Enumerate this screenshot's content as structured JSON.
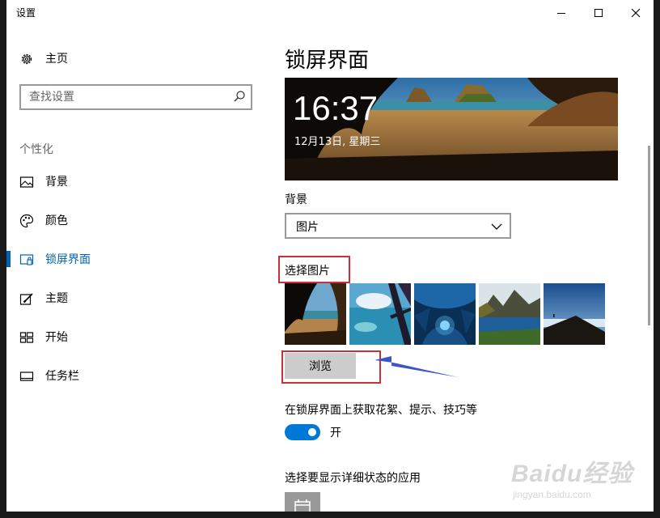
{
  "window": {
    "title": "设置",
    "controls": [
      "minimize",
      "maximize",
      "close"
    ]
  },
  "sidebar": {
    "home_label": "主页",
    "home_icon": "gear-icon",
    "search_placeholder": "查找设置",
    "search_icon": "search-icon",
    "section_label": "个性化",
    "items": [
      {
        "label": "背景",
        "icon": "image-icon",
        "active": false
      },
      {
        "label": "颜色",
        "icon": "palette-icon",
        "active": false
      },
      {
        "label": "锁屏界面",
        "icon": "lock-screen-icon",
        "active": true
      },
      {
        "label": "主题",
        "icon": "brush-icon",
        "active": false
      },
      {
        "label": "开始",
        "icon": "start-icon",
        "active": false
      },
      {
        "label": "任务栏",
        "icon": "taskbar-icon",
        "active": false
      }
    ],
    "accent_color": "#0063b1"
  },
  "main": {
    "title": "锁屏界面",
    "preview": {
      "time": "16:37",
      "date": "12月13日, 星期三"
    },
    "background_label": "背景",
    "background_value": "图片",
    "choose_picture_label": "选择图片",
    "thumbnails": [
      "beach-cave",
      "window-sea",
      "ice-cave",
      "mountain-lake",
      "coast-sunrise"
    ],
    "browse_label": "浏览",
    "spotlight_label": "在锁屏界面上获取花絮、提示、技巧等",
    "toggle": {
      "state": "on",
      "label": "开"
    },
    "detail_apps_label": "选择要显示详细状态的应用",
    "detail_app_icon": "calendar-icon"
  },
  "annotations": {
    "highlight_color": "#c8303a",
    "arrow_color": "#3b55c9"
  },
  "watermark": {
    "logo": "Baidu经验",
    "url": "jingyan.baidu.com"
  }
}
